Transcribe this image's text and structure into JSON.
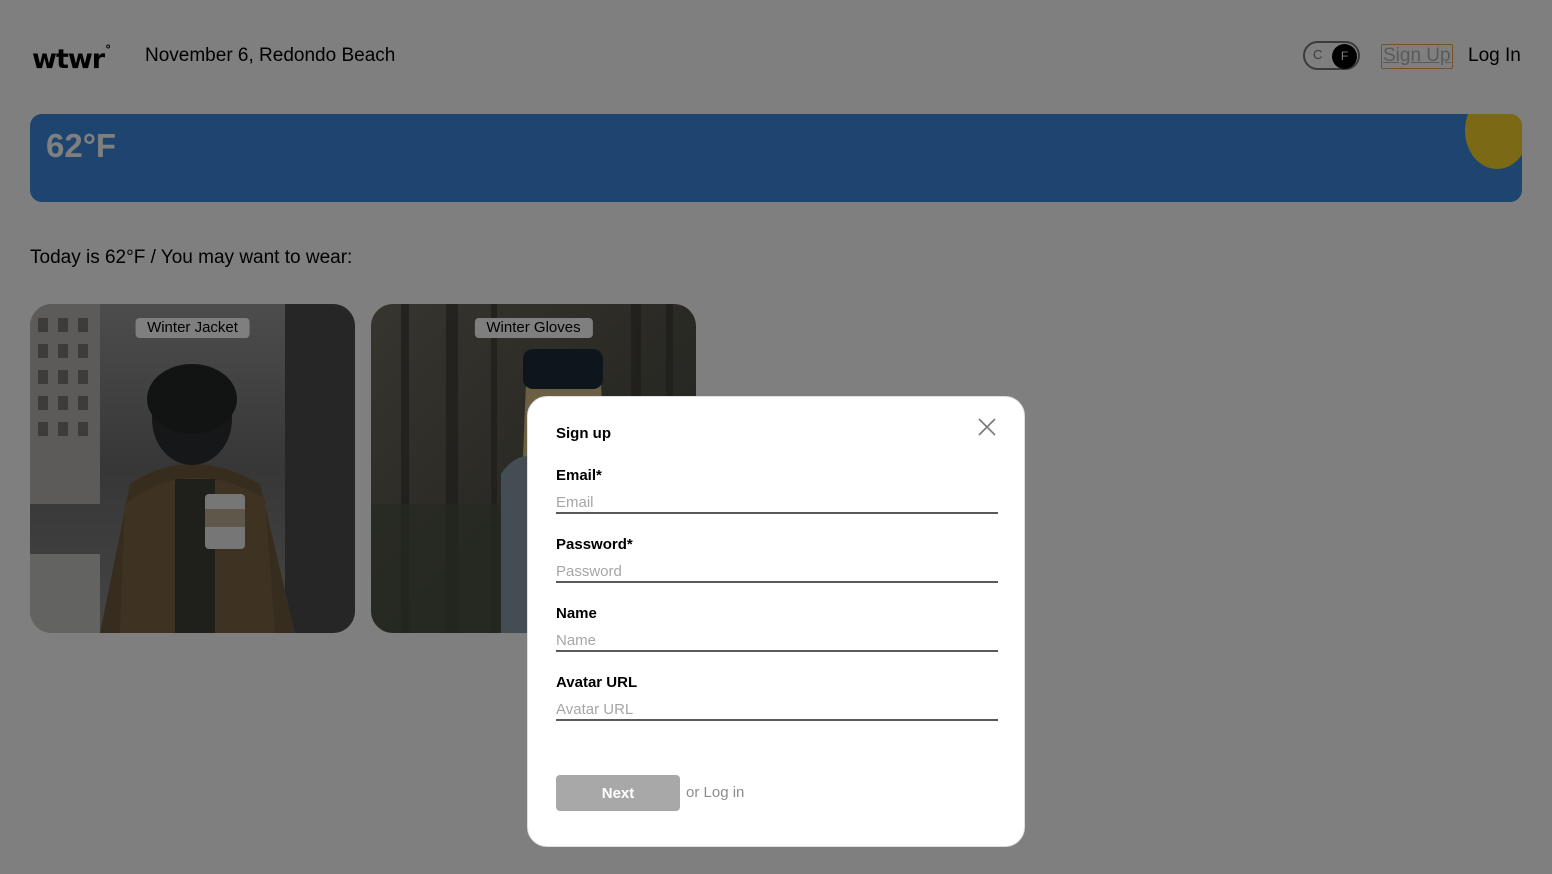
{
  "header": {
    "logo": "wtwr",
    "logo_mark": "°",
    "date_location": "November 6, Redondo Beach",
    "unit_toggle": {
      "off_label": "C",
      "on_label": "F",
      "selected": "F"
    },
    "signup_label": "Sign Up",
    "login_label": "Log In"
  },
  "weather": {
    "temperature": "62°F",
    "condition_icon": "sun-icon",
    "card_color": "#3a8be0",
    "sun_color": "#f6d22b"
  },
  "main": {
    "today_text": "Today is 62°F / You may want to wear:",
    "items": [
      {
        "name": "Winter Jacket"
      },
      {
        "name": "Winter Gloves"
      }
    ]
  },
  "modal": {
    "title": "Sign up",
    "fields": [
      {
        "label": "Email*",
        "placeholder": "Email",
        "value": ""
      },
      {
        "label": "Password*",
        "placeholder": "Password",
        "value": ""
      },
      {
        "label": "Name",
        "placeholder": "Name",
        "value": ""
      },
      {
        "label": "Avatar URL",
        "placeholder": "Avatar URL",
        "value": ""
      }
    ],
    "submit_label": "Next",
    "alt_link": "or Log in",
    "close_icon": "close-icon"
  },
  "colors": {
    "overlay": "rgba(0,0,0,0.5)",
    "signup_focus_outline": "#e8a35b",
    "disabled_button": "#a8a8a8"
  }
}
